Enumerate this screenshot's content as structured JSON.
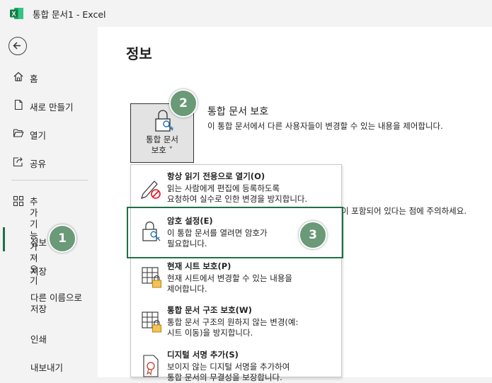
{
  "window": {
    "title": "통합 문서1  -  Excel"
  },
  "sidebar": {
    "items": [
      {
        "label": "홈"
      },
      {
        "label": "새로 만들기"
      },
      {
        "label": "열기"
      },
      {
        "label": "공유"
      },
      {
        "label": "추가 기능 가져\n오기"
      },
      {
        "label": "정보"
      },
      {
        "label": "저장"
      },
      {
        "label": "다른 이름으로\n저장"
      },
      {
        "label": "인쇄"
      },
      {
        "label": "내보내기"
      }
    ]
  },
  "main": {
    "title": "정보",
    "protect": {
      "button_label": "통합 문서\n보호 ˅",
      "heading": "통합 문서 보호",
      "description": "이 통합 문서에서 다른 사용자들이 변경할 수 있는 내용을 제어합니다."
    },
    "partial_text": "이 포함되어 있다는 점에 주의하세요."
  },
  "dropdown": {
    "items": [
      {
        "title": "항상 읽기 전용으로 열기(O)",
        "description": "읽는 사람에게 편집에 등록하도록\n요청하여 실수로 인한 변경을 방지합니다."
      },
      {
        "title": "암호 설정(E)",
        "description": "이 통합 문서를 열려면 암호가\n필요합니다."
      },
      {
        "title": "현재 시트 보호(P)",
        "description": "현재 시트에서 변경할 수 있는 내용을\n제어합니다."
      },
      {
        "title": "통합 문서 구조 보호(W)",
        "description": "통합 문서 구조의 원하지 않는 변경(예:\n시트 이동)을 방지합니다."
      },
      {
        "title": "디지털 서명 추가(S)",
        "description": "보이지 않는 디지털 서명을 추가하여\n통합 문서의 무결성을 보장합니다."
      }
    ]
  },
  "badges": [
    "1",
    "2",
    "3"
  ],
  "colors": {
    "accent": "#1e7145",
    "badge": "#6a9a78",
    "warning": "#e81123"
  }
}
